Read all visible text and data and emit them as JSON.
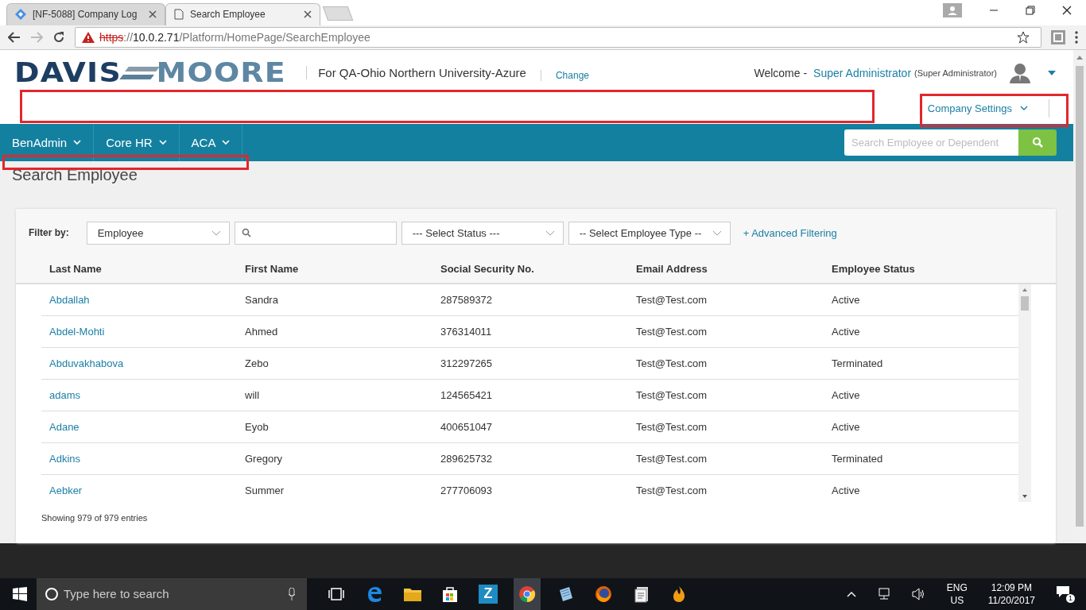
{
  "browser": {
    "tabs": [
      {
        "title": "[NF-5088] Company Log",
        "selected": false
      },
      {
        "title": "Search Employee",
        "selected": true
      }
    ],
    "url": {
      "scheme": "https",
      "separator": "://",
      "host": "10.0.2.71",
      "path": "/Platform/HomePage/SearchEmployee"
    }
  },
  "header": {
    "logo": [
      "DAVIS",
      "MOORE"
    ],
    "company": "For QA-Ohio Northern University-Azure",
    "change": "Change",
    "welcome": "Welcome -",
    "user": "Super Administrator",
    "role": "(Super Administrator)",
    "company_settings": "Company Settings"
  },
  "nav": {
    "items": [
      "BenAdmin",
      "Core HR",
      "ACA"
    ],
    "search": {
      "placeholder": "Search Employee or Dependent"
    }
  },
  "page_title": "Search Employee",
  "filter": {
    "label": "Filter by:",
    "type": "Employee",
    "status": "--- Select Status ---",
    "employee_type": "-- Select Employee Type --",
    "advanced": "+ Advanced Filtering"
  },
  "table": {
    "columns": [
      "Last Name",
      "First Name",
      "Social Security No.",
      "Email Address",
      "Employee Status"
    ],
    "rows": [
      [
        "Abdallah",
        "Sandra",
        "287589372",
        "Test@Test.com",
        "Active"
      ],
      [
        "Abdel-Mohti",
        "Ahmed",
        "376314011",
        "Test@Test.com",
        "Active"
      ],
      [
        "Abduvakhabova",
        "Zebo",
        "312297265",
        "Test@Test.com",
        "Terminated"
      ],
      [
        "adams",
        "will",
        "124565421",
        "Test@Test.com",
        "Active"
      ],
      [
        "Adane",
        "Eyob",
        "400651047",
        "Test@Test.com",
        "Active"
      ],
      [
        "Adkins",
        "Gregory",
        "289625732",
        "Test@Test.com",
        "Terminated"
      ],
      [
        "Aebker",
        "Summer",
        "277706093",
        "Test@Test.com",
        "Active"
      ]
    ]
  },
  "entries": "Showing 979 of 979 entries",
  "taskbar": {
    "search": {
      "placeholder": "Type here to search"
    },
    "zapp": "Z",
    "lang": [
      "ENG",
      "US"
    ],
    "time": "12:09 PM",
    "date": "11/20/2017",
    "notifications": "1"
  }
}
